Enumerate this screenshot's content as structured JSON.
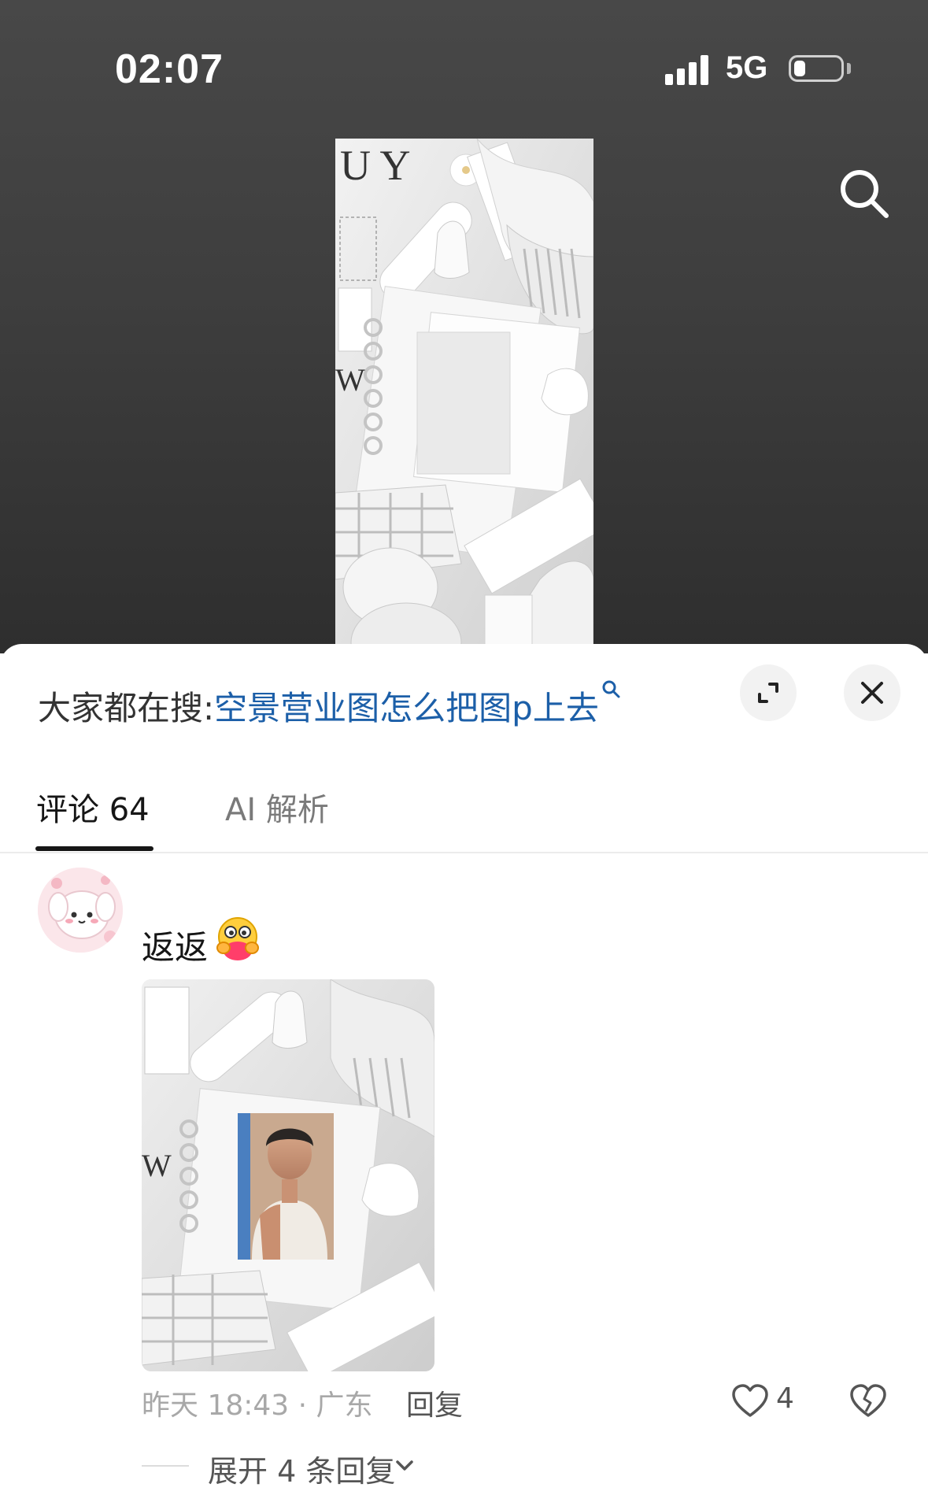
{
  "status_bar": {
    "time": "02:07",
    "network": "5G",
    "battery_level": 0.25
  },
  "search_banner": {
    "prefix": "大家都在搜:",
    "query": "空景营业图怎么把图p上去"
  },
  "tabs": [
    {
      "label": "评论 64",
      "active": true
    },
    {
      "label": "AI 解析",
      "active": false
    }
  ],
  "comment": {
    "text": "返返",
    "emoji": "hug-emoji",
    "time_location": "昨天 18:43 · 广东",
    "reply_label": "回复",
    "like_count": "4",
    "expand_replies": "展开 4 条回复"
  },
  "colors": {
    "link_blue": "#1c5fa8",
    "text_primary": "#161616",
    "text_secondary": "#a8a8a8"
  }
}
